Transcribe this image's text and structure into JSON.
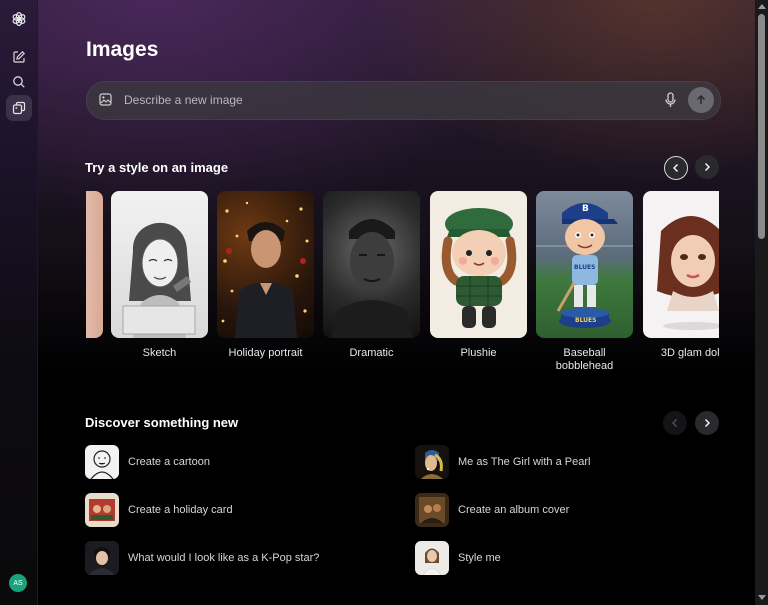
{
  "sidebar": {
    "avatar_initials": "AS"
  },
  "page": {
    "title": "Images"
  },
  "search": {
    "placeholder": "Describe a new image"
  },
  "styles_section": {
    "title": "Try a style on an image",
    "cards": [
      {
        "label": ""
      },
      {
        "label": "Sketch"
      },
      {
        "label": "Holiday portrait"
      },
      {
        "label": "Dramatic"
      },
      {
        "label": "Plushie"
      },
      {
        "label": "Baseball bobblehead"
      },
      {
        "label": "3D glam doll"
      }
    ]
  },
  "discover_section": {
    "title": "Discover something new",
    "items": [
      {
        "label": "Create a cartoon"
      },
      {
        "label": "Me as The Girl with a Pearl"
      },
      {
        "label": "Create a holiday card"
      },
      {
        "label": "Create an album cover"
      },
      {
        "label": "What would I look like as a K-Pop star?"
      },
      {
        "label": "Style me"
      }
    ]
  },
  "badge_text": "BLUES",
  "colors": {
    "accent_avatar": "#1aa37a",
    "send_button": "#6a6870"
  }
}
